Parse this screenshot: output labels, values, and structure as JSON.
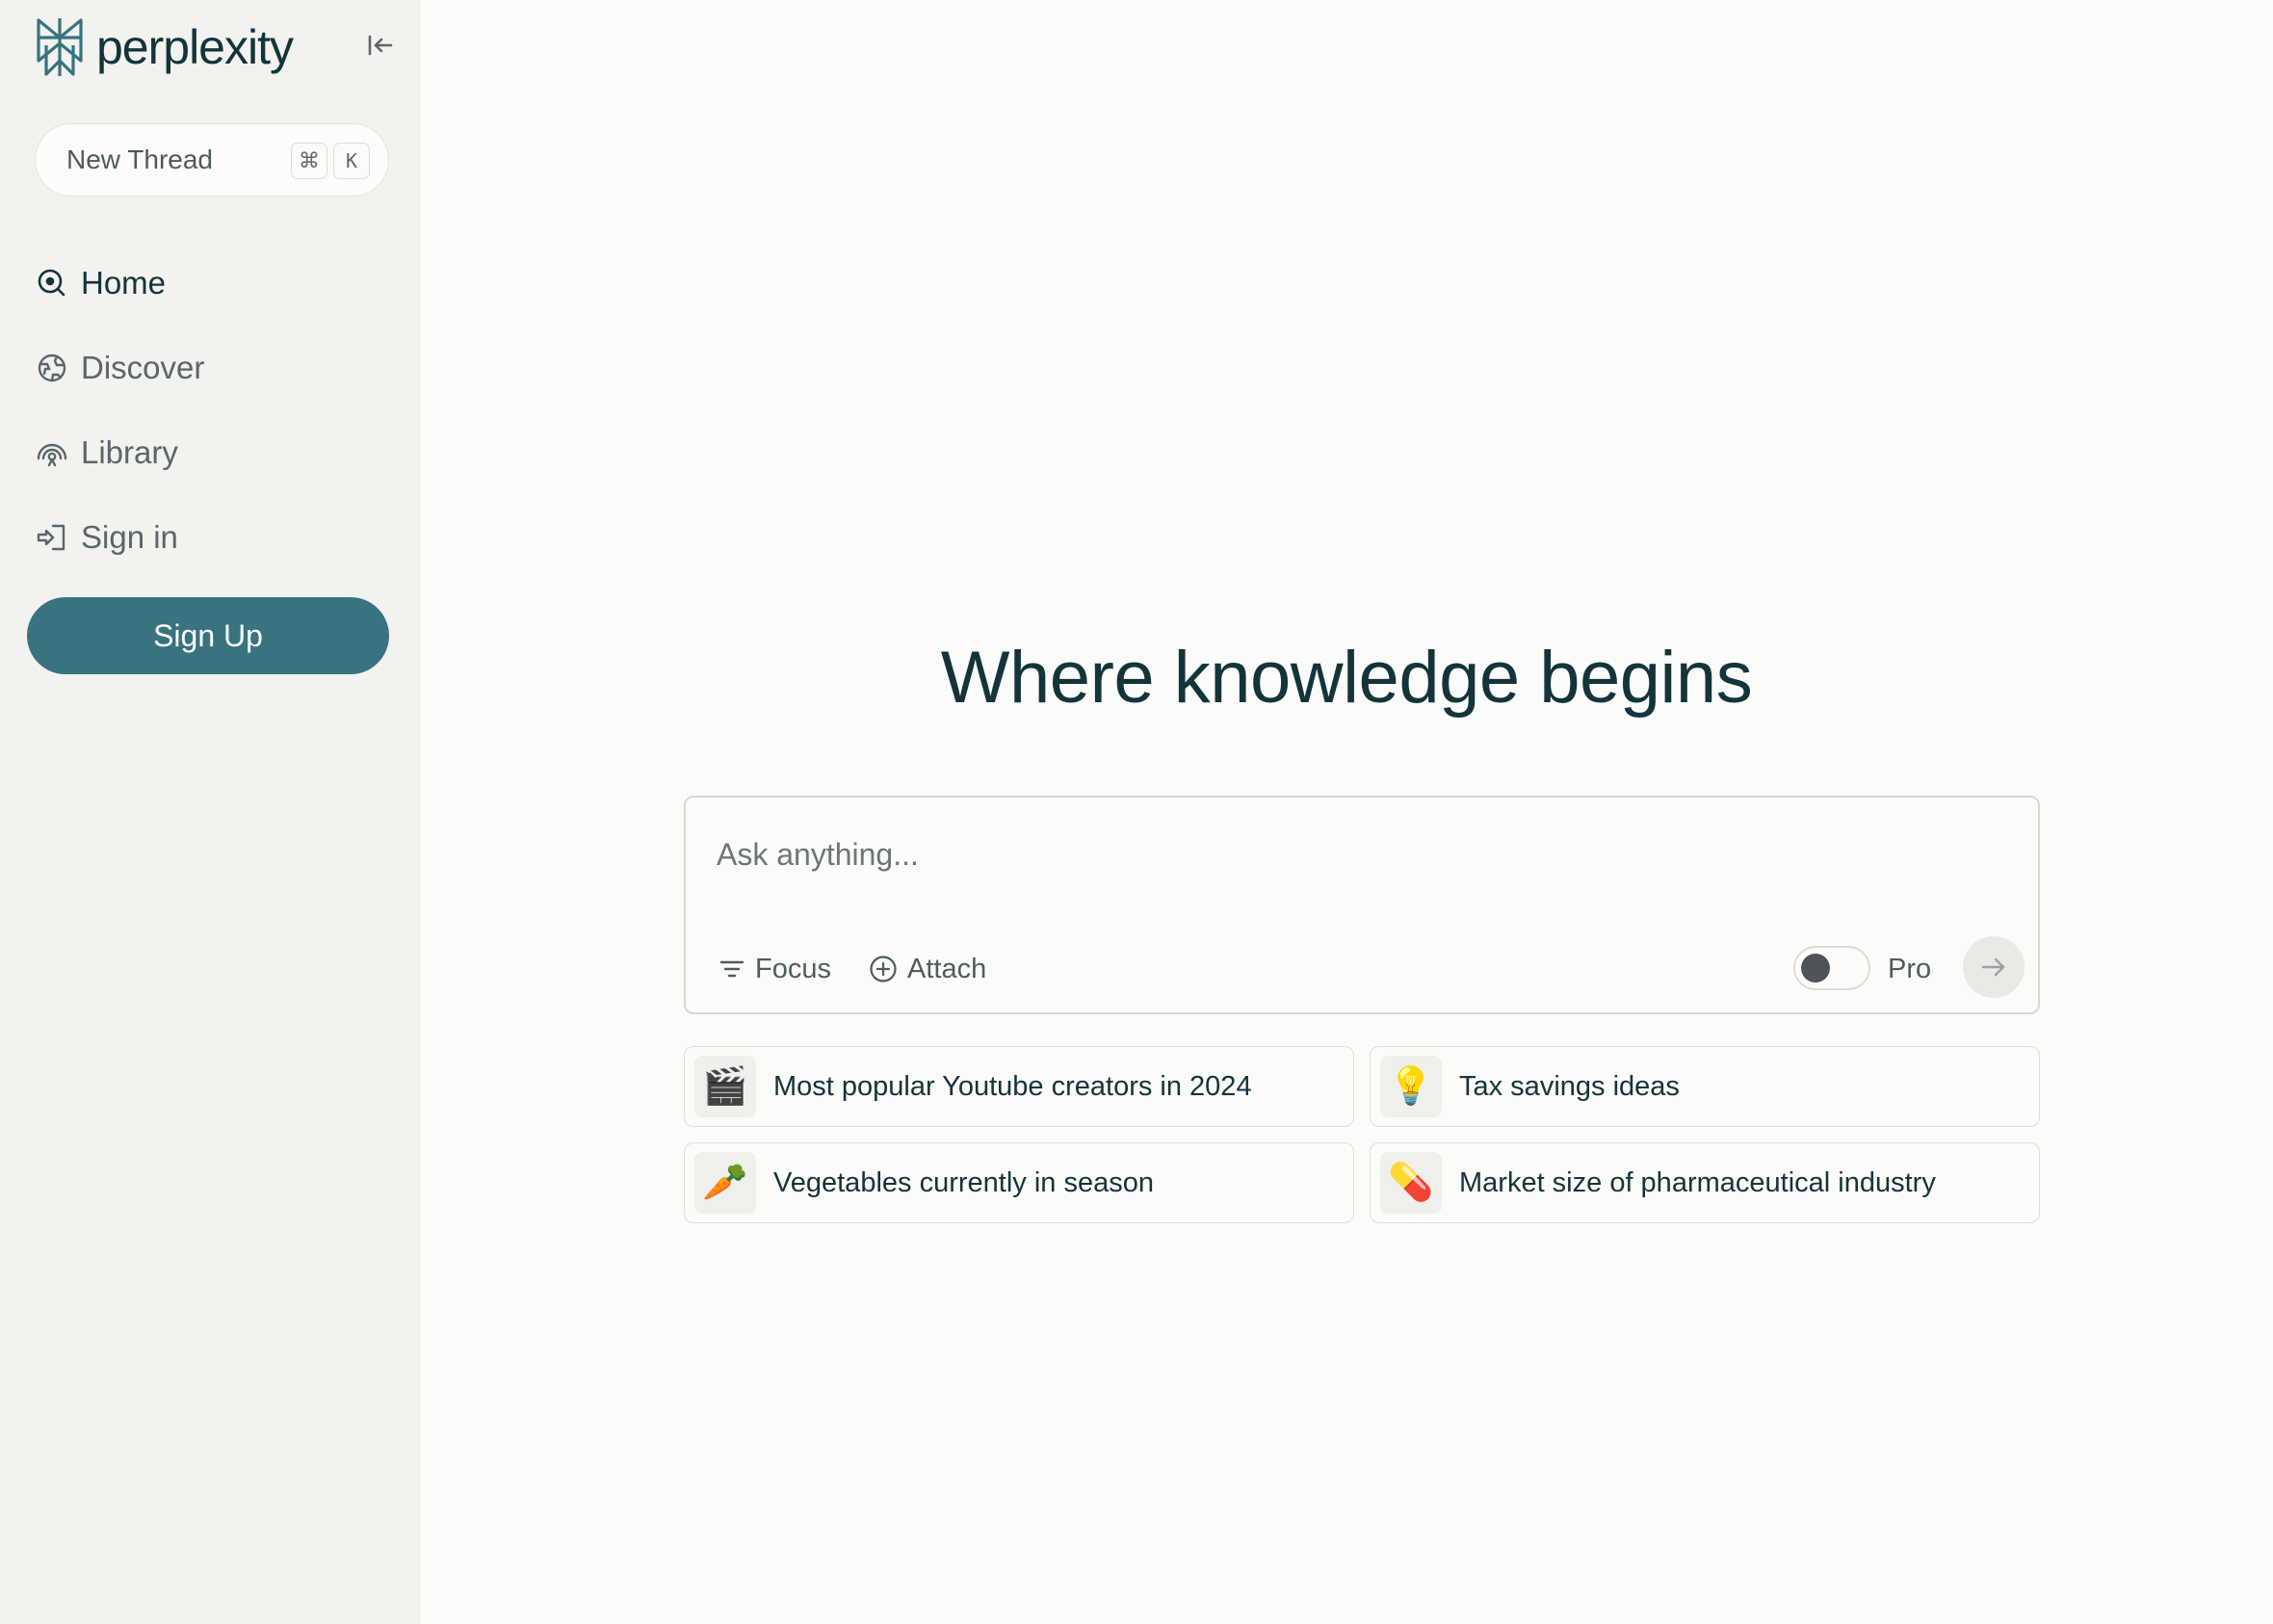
{
  "brand": {
    "name": "perplexity",
    "accent": "#38737f"
  },
  "sidebar": {
    "new_thread": {
      "label": "New Thread",
      "shortcut_cmd": "⌘",
      "shortcut_key": "K"
    },
    "nav": [
      {
        "label": "Home",
        "icon": "search-circle-icon",
        "active": true
      },
      {
        "label": "Discover",
        "icon": "globe-icon",
        "active": false
      },
      {
        "label": "Library",
        "icon": "library-icon",
        "active": false
      },
      {
        "label": "Sign in",
        "icon": "sign-in-icon",
        "active": false
      }
    ],
    "signup_label": "Sign Up"
  },
  "main": {
    "headline": "Where knowledge begins",
    "search": {
      "placeholder": "Ask anything...",
      "focus_label": "Focus",
      "attach_label": "Attach",
      "pro_label": "Pro",
      "pro_enabled": false
    },
    "suggestions": [
      {
        "emoji": "🎬",
        "text": "Most popular Youtube creators in 2024"
      },
      {
        "emoji": "💡",
        "text": "Tax savings ideas"
      },
      {
        "emoji": "🥕",
        "text": "Vegetables currently in season"
      },
      {
        "emoji": "💊",
        "text": "Market size of pharmaceutical industry"
      }
    ]
  }
}
